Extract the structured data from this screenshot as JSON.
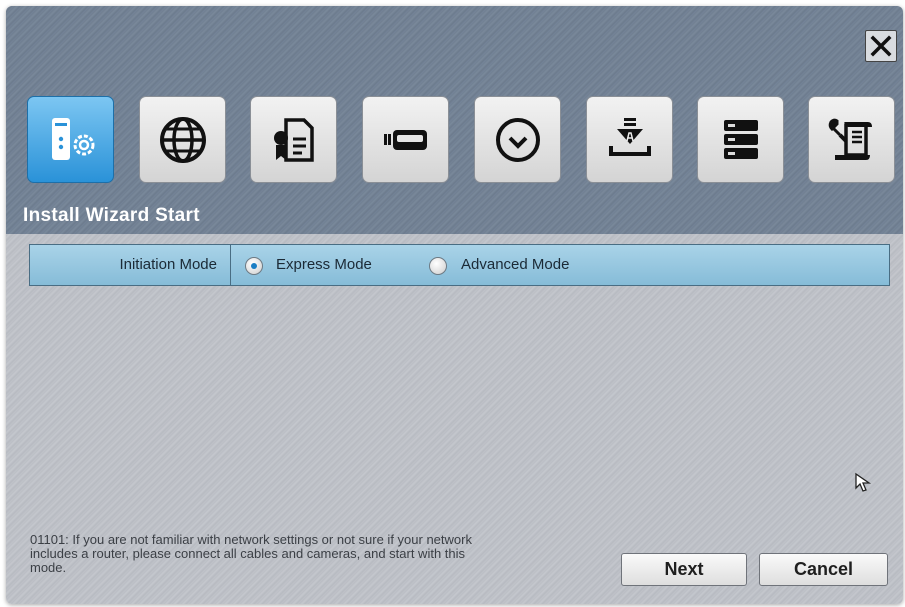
{
  "header": {
    "title": "Install Wizard Start",
    "close_icon": "close-icon",
    "steps": [
      {
        "icon": "system-settings-icon",
        "active": true
      },
      {
        "icon": "globe-network-icon",
        "active": false
      },
      {
        "icon": "license-document-icon",
        "active": false
      },
      {
        "icon": "storage-drive-icon",
        "active": false
      },
      {
        "icon": "clock-icon",
        "active": false
      },
      {
        "icon": "download-install-icon",
        "active": false
      },
      {
        "icon": "server-stack-icon",
        "active": false
      },
      {
        "icon": "tools-icon",
        "active": false
      }
    ]
  },
  "initiation": {
    "label": "Initiation Mode",
    "options": [
      {
        "label": "Express Mode",
        "selected": true
      },
      {
        "label": "Advanced Mode",
        "selected": false
      }
    ]
  },
  "note": "01101: If you are not familiar with network settings or not sure if your network includes a router, please connect all cables and cameras, and start with this mode.",
  "buttons": {
    "next": "Next",
    "cancel": "Cancel"
  },
  "colors": {
    "header": "#76859a",
    "active_tile": "#2a92d8",
    "mode_row": "#98c8e0",
    "radio_dot": "#1b7ec4"
  }
}
